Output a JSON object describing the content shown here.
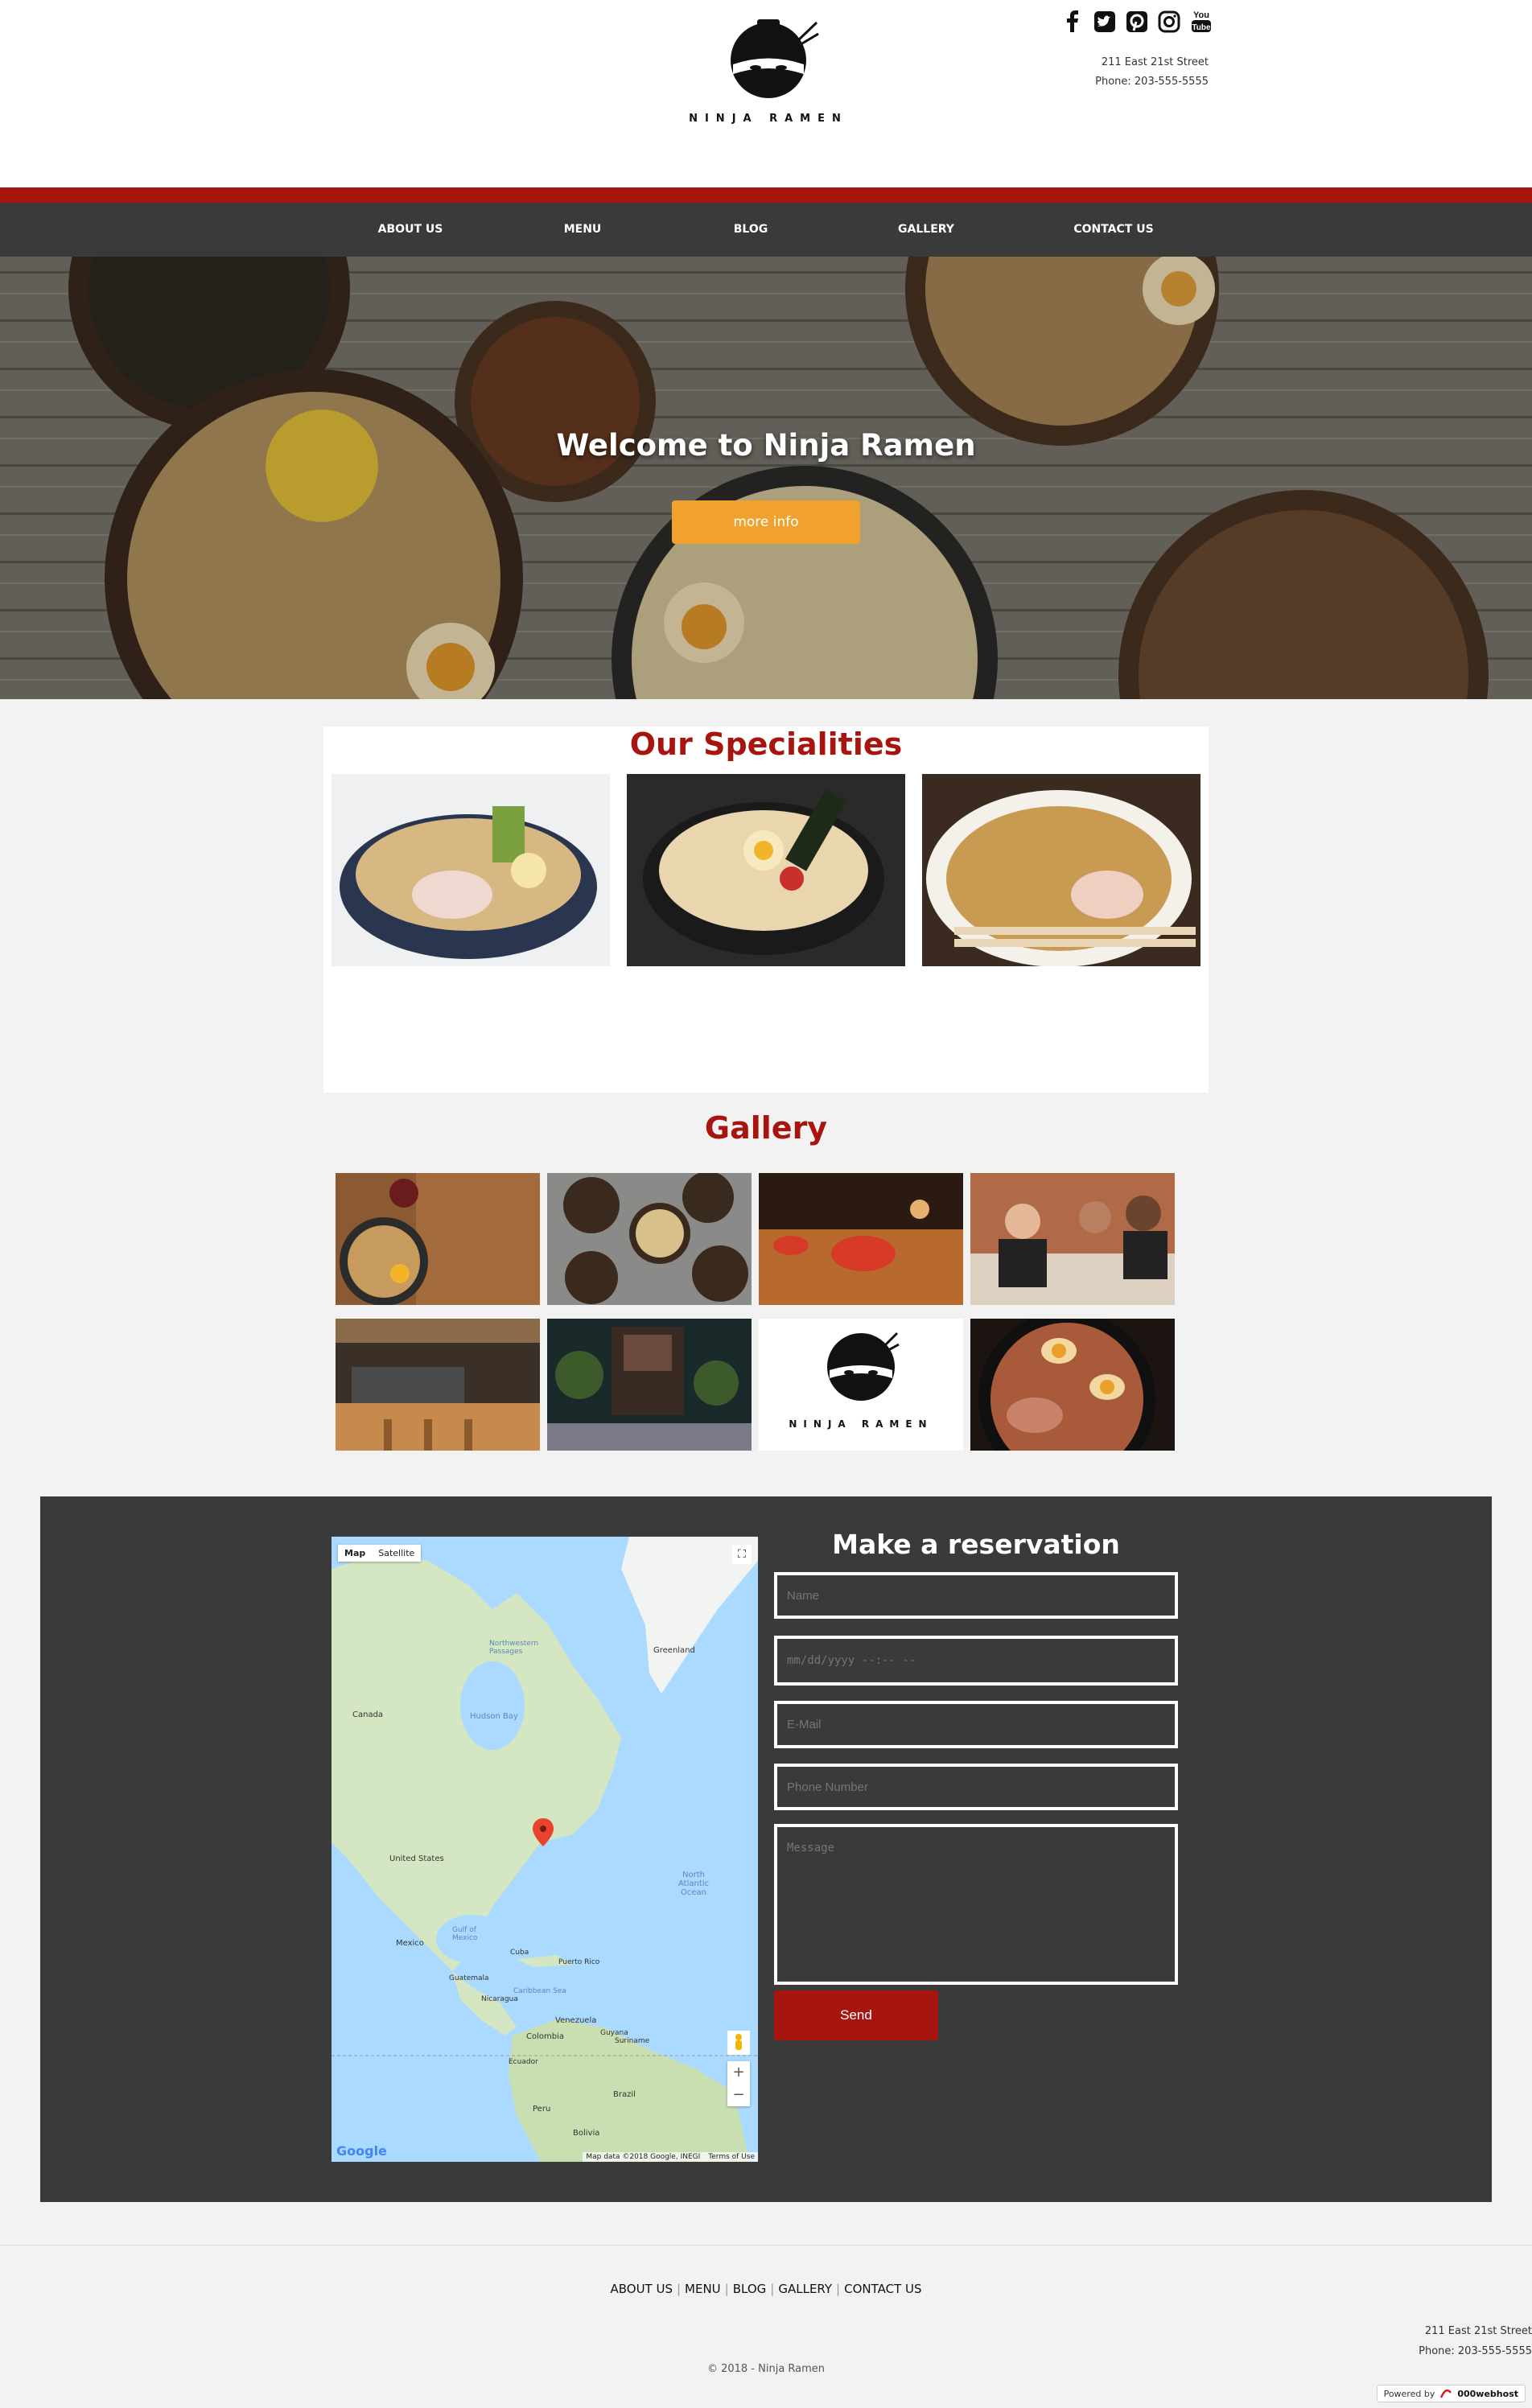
{
  "header": {
    "logo_text": "NINJA RAMEN",
    "social": [
      "facebook-icon",
      "twitter-icon",
      "pinterest-icon",
      "instagram-icon",
      "youtube-icon"
    ],
    "address": "211 East 21st Street",
    "phone": "Phone: 203-555-5555"
  },
  "nav": {
    "items": [
      "ABOUT US",
      "MENU",
      "BLOG",
      "GALLERY",
      "CONTACT US"
    ]
  },
  "hero": {
    "title": "Welcome to Ninja Ramen",
    "button": "more info"
  },
  "specialities": {
    "title": "Our Specialities"
  },
  "gallery": {
    "title": "Gallery",
    "logo_text": "NINJA RAMEN"
  },
  "reservation": {
    "title": "Make a reservation",
    "name_placeholder": "Name",
    "date_placeholder": "mm/dd/yyyy --:-- --",
    "email_placeholder": "E-Mail",
    "phone_placeholder": "Phone Number",
    "message_placeholder": "Message",
    "send": "Send"
  },
  "map": {
    "tab_map": "Map",
    "tab_satellite": "Satellite",
    "zoom_in": "+",
    "zoom_out": "−",
    "google": "Google",
    "data_credit": "Map data ©2018 Google, INEGI",
    "terms": "Terms of Use",
    "labels": {
      "greenland": "Greenland",
      "canada": "Canada",
      "hudson": "Hudson Bay",
      "nw_passages": "Northwestern Passages",
      "us": "United States",
      "mexico": "Mexico",
      "gulf": "Gulf of Mexico",
      "atlantic": "North Atlantic Ocean",
      "cuba": "Cuba",
      "puerto_rico": "Puerto Rico",
      "guatemala": "Guatemala",
      "nicaragua": "Nicaragua",
      "caribbean": "Caribbean Sea",
      "venezuela": "Venezuela",
      "guyana": "Guyana",
      "suriname": "Suriname",
      "colombia": "Colombia",
      "ecuador": "Ecuador",
      "peru": "Peru",
      "brazil": "Brazil",
      "bolivia": "Bolivia"
    }
  },
  "footer": {
    "items": [
      "ABOUT US",
      "MENU",
      "BLOG",
      "GALLERY",
      "CONTACT US"
    ],
    "address": "211 East 21st Street",
    "phone": "Phone: 203-555-5555",
    "copyright": "© 2018 - Ninja Ramen",
    "powered_by": "Powered by",
    "host": "000webhost"
  }
}
